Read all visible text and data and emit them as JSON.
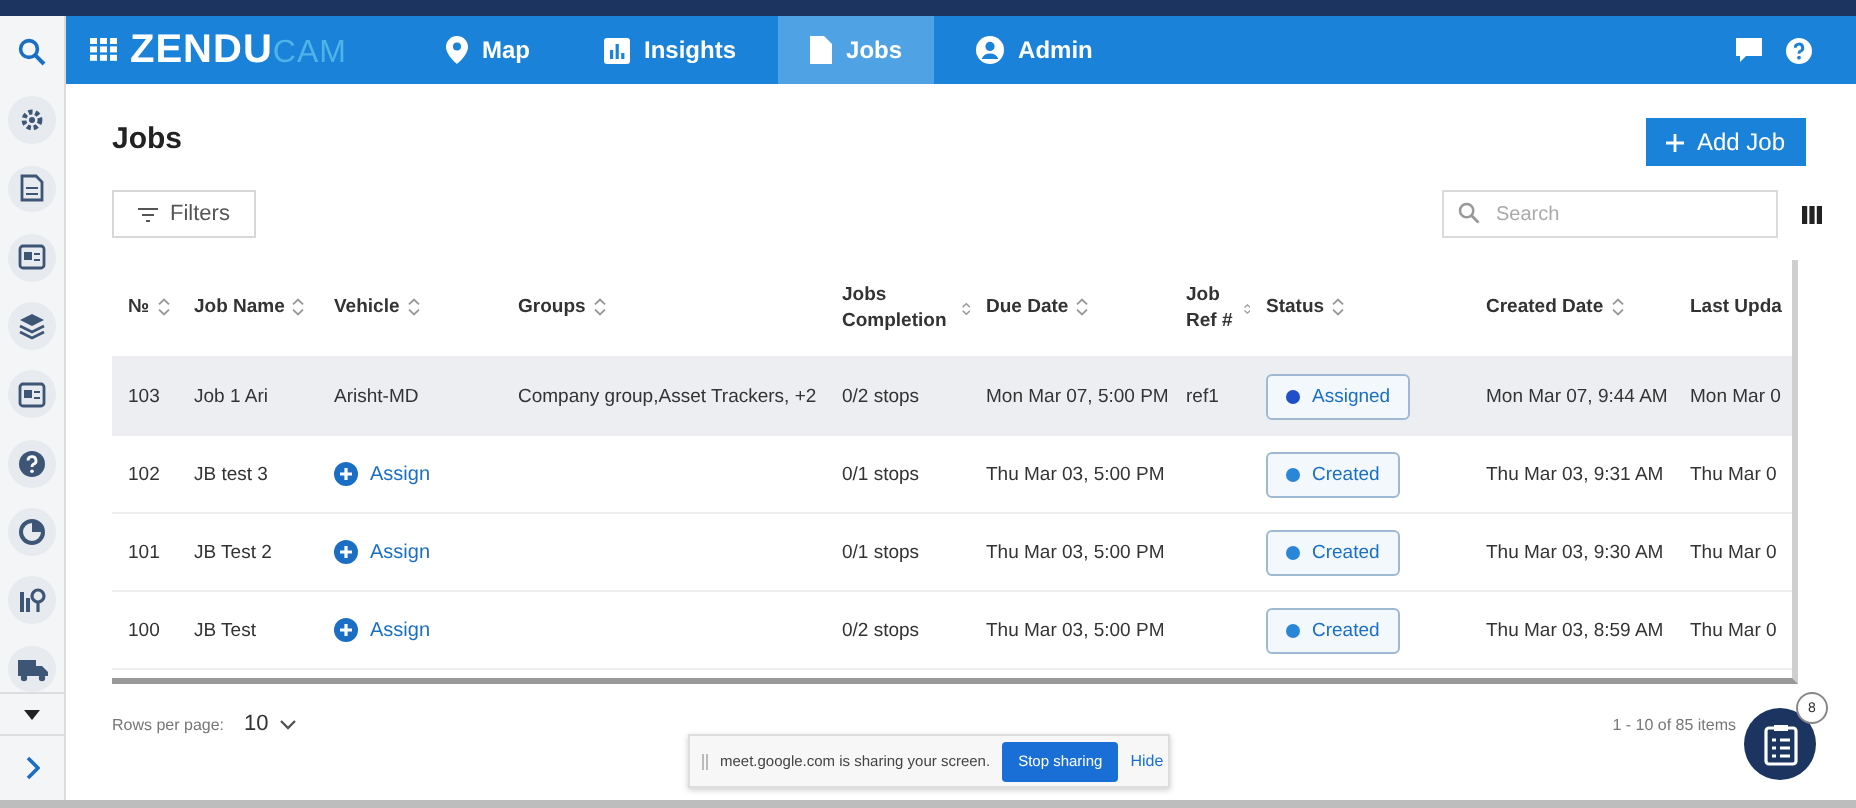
{
  "top_bar": {
    "logo_primary": "ZENDU",
    "logo_secondary": "CAM",
    "nav": [
      {
        "label": "Map",
        "selected": false
      },
      {
        "label": "Insights",
        "selected": false
      },
      {
        "label": "Jobs",
        "selected": true
      },
      {
        "label": "Admin",
        "selected": false
      }
    ]
  },
  "page": {
    "title": "Jobs",
    "add_button": "Add Job",
    "filters_button": "Filters",
    "search": {
      "placeholder": "Search"
    }
  },
  "table": {
    "columns": [
      {
        "label": "№",
        "sortable": true
      },
      {
        "label": "Job Name",
        "sortable": true
      },
      {
        "label": "Vehicle",
        "sortable": true
      },
      {
        "label": "Groups",
        "sortable": true
      },
      {
        "label": "Jobs Completion",
        "sortable": true
      },
      {
        "label": "Due Date",
        "sortable": true
      },
      {
        "label": "Job Ref #",
        "sortable": true
      },
      {
        "label": "Status",
        "sortable": true
      },
      {
        "label": "Created Date",
        "sortable": true
      },
      {
        "label": "Last Upda",
        "sortable": false
      }
    ],
    "rows": [
      {
        "highlighted": true,
        "number": "103",
        "job_name": "Job 1 Ari",
        "vehicle": {
          "kind": "text",
          "label": "Arisht-MD"
        },
        "groups": "Company group,Asset Trackers, +2",
        "completion": "0/2 stops",
        "due_date": "Mon Mar 07, 5:00 PM",
        "job_ref": "ref1",
        "status": {
          "label": "Assigned",
          "color": "#1f4fc9"
        },
        "created_date": "Mon Mar 07, 9:44 AM",
        "last_updated": "Mon Mar 0"
      },
      {
        "highlighted": false,
        "number": "102",
        "job_name": "JB test 3",
        "vehicle": {
          "kind": "assign",
          "label": "Assign"
        },
        "groups": "",
        "completion": "0/1 stops",
        "due_date": "Thu Mar 03, 5:00 PM",
        "job_ref": "",
        "status": {
          "label": "Created",
          "color": "#2a86d6"
        },
        "created_date": "Thu Mar 03, 9:31 AM",
        "last_updated": "Thu Mar 0"
      },
      {
        "highlighted": false,
        "number": "101",
        "job_name": "JB Test 2",
        "vehicle": {
          "kind": "assign",
          "label": "Assign"
        },
        "groups": "",
        "completion": "0/1 stops",
        "due_date": "Thu Mar 03, 5:00 PM",
        "job_ref": "",
        "status": {
          "label": "Created",
          "color": "#2a86d6"
        },
        "created_date": "Thu Mar 03, 9:30 AM",
        "last_updated": "Thu Mar 0"
      },
      {
        "highlighted": false,
        "number": "100",
        "job_name": "JB Test",
        "vehicle": {
          "kind": "assign",
          "label": "Assign"
        },
        "groups": "",
        "completion": "0/2 stops",
        "due_date": "Thu Mar 03, 5:00 PM",
        "job_ref": "",
        "status": {
          "label": "Created",
          "color": "#2a86d6"
        },
        "created_date": "Thu Mar 03, 8:59 AM",
        "last_updated": "Thu Mar 0"
      }
    ]
  },
  "footer": {
    "rows_per_page_label": "Rows per page:",
    "rows_per_page": "10",
    "range": "1 - 10 of 85 items"
  },
  "share_bar": {
    "message": "meet.google.com is sharing your screen.",
    "stop_button": "Stop sharing",
    "hide_button": "Hide"
  },
  "tasks_button": {
    "badge": "8"
  }
}
